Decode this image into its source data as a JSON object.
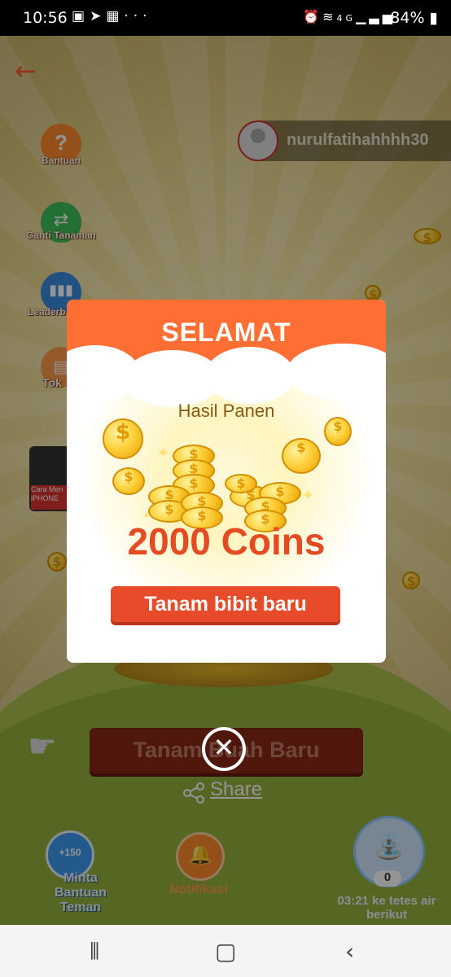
{
  "status_bar": {
    "time": "10:56",
    "notification_icons": [
      "shopee-icon",
      "telegram-icon",
      "gallery-icon",
      "more-dots-icon"
    ],
    "system_icons": [
      "alarm-icon",
      "wifi-icon",
      "4g-icon",
      "signal-icon"
    ],
    "battery": "84%"
  },
  "header": {
    "username": "nurulfatihahhhh30"
  },
  "sidebar": {
    "items": [
      {
        "label": "Bantuan"
      },
      {
        "label": "Ganti Tanaman"
      },
      {
        "label": "Leaderb"
      },
      {
        "label": "Tok"
      },
      {
        "label": "Cara Men iPHONE"
      }
    ]
  },
  "modal": {
    "title": "SELAMAT",
    "subtitle": "Hasil Panen",
    "reward": "2000 Coins",
    "button_label": "Tanam bibit baru"
  },
  "main": {
    "plant_button_label": "Tanam Buah Baru",
    "share_label": "Share"
  },
  "bottom": {
    "help_badge": "+150",
    "help_label": "Minta Bantuan Teman",
    "notif_label": "Notifikasi",
    "water_count": "0",
    "water_timer": "03:21 ke tetes air berikut"
  },
  "colors": {
    "accent": "#ff6e33",
    "reward_text": "#e54b22",
    "cta": "#e84b2a"
  }
}
